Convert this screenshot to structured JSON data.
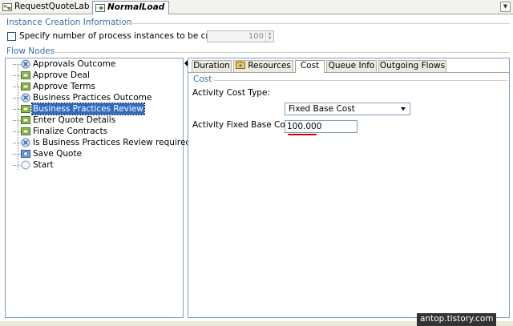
{
  "editor_tabs": [
    {
      "label": "RequestQuoteLab"
    },
    {
      "label": "NormalLoad"
    }
  ],
  "instance_creation": {
    "title": "Instance Creation Information",
    "checkbox_label": "Specify number of process instances to be created",
    "checked": false,
    "spinner_value": "100"
  },
  "flow_nodes": {
    "title": "Flow Nodes",
    "items": [
      {
        "label": "Approvals Outcome",
        "icon": "gateway-icon"
      },
      {
        "label": "Approve Deal",
        "icon": "task-icon"
      },
      {
        "label": "Approve Terms",
        "icon": "task-icon"
      },
      {
        "label": "Business Practices Outcome",
        "icon": "gateway-icon"
      },
      {
        "label": "Business Practices Review",
        "icon": "task-icon",
        "selected": true
      },
      {
        "label": "Enter Quote Details",
        "icon": "task-icon"
      },
      {
        "label": "Finalize Contracts",
        "icon": "task-icon"
      },
      {
        "label": "Is Business Practices Review required?",
        "icon": "gateway-icon"
      },
      {
        "label": "Save Quote",
        "icon": "service-task-icon"
      },
      {
        "label": "Start",
        "icon": "start-event-icon"
      }
    ]
  },
  "detail_tabs": [
    {
      "label": "Duration"
    },
    {
      "label": "Resources"
    },
    {
      "label": "Cost",
      "active": true
    },
    {
      "label": "Queue Info"
    },
    {
      "label": "Outgoing Flows"
    }
  ],
  "cost": {
    "title": "Cost",
    "type_label": "Activity Cost Type:",
    "type_value": "Fixed Base Cost",
    "fixed_label": "Activity Fixed Base Cost:",
    "fixed_value": "100.000"
  },
  "watermark": "antop.tistory.com",
  "colors": {
    "section_title": "#3a6ea5",
    "selection": "#316ac5",
    "annotation_red": "#d00000"
  }
}
